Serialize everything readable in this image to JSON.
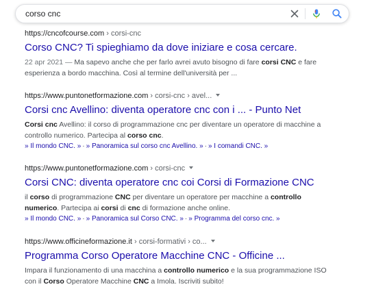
{
  "search": {
    "query": "corso cnc"
  },
  "results": [
    {
      "cite_domain": "https://cncofcourse.com",
      "cite_path": " › corsi-cnc",
      "title": "Corso CNC? Ti spieghiamo da dove iniziare e cosa cercare.",
      "snippet": [
        [
          {
            "t": "22 apr 2021 — ",
            "d": true
          },
          {
            "t": "Ma sapevo anche che per farlo avrei avuto bisogno di fare "
          },
          {
            "t": "corsi CNC",
            "b": true
          },
          {
            "t": " e fare"
          }
        ],
        [
          {
            "t": "esperienza a bordo macchina. Così al termine dell'università per ..."
          }
        ]
      ]
    },
    {
      "cite_domain": "https://www.puntonetformazione.com",
      "cite_path": " › corsi-cnc › avel...",
      "title": "Corsi cnc Avellino: diventa operatore cnc con i ... - Punto Net",
      "snippet": [
        [
          {
            "t": "Corsi cnc",
            "b": true
          },
          {
            "t": " Avellino: il corso di programmazione cnc per diventare un operatore di macchine a"
          }
        ],
        [
          {
            "t": "controllo numerico. Partecipa al "
          },
          {
            "t": "corso cnc",
            "b": true
          },
          {
            "t": "."
          }
        ]
      ],
      "sitelinks": [
        "» Il mondo CNC. »",
        "» Panoramica sul corso cnc Avellino. »",
        "» I comandi CNC. »"
      ]
    },
    {
      "cite_domain": "https://www.puntonetformazione.com",
      "cite_path": " › corsi-cnc",
      "title": "Corsi CNC: diventa operatore cnc coi Corsi di Formazione CNC",
      "snippet": [
        [
          {
            "t": "il "
          },
          {
            "t": "corso",
            "b": true
          },
          {
            "t": " di programmazione "
          },
          {
            "t": "CNC",
            "b": true
          },
          {
            "t": " per diventare un operatore per macchine a "
          },
          {
            "t": "controllo",
            "b": true
          }
        ],
        [
          {
            "t": "numerico",
            "b": true
          },
          {
            "t": ". Partecipa ai "
          },
          {
            "t": "corsi",
            "b": true
          },
          {
            "t": " di "
          },
          {
            "t": "cnc",
            "b": true
          },
          {
            "t": " di formazione anche online."
          }
        ]
      ],
      "sitelinks": [
        "» Il mondo CNC. »",
        "» Panoramica sul Corso CNC. »",
        "» Programma del corso cnc. »"
      ]
    },
    {
      "cite_domain": "https://www.officineformazione.it",
      "cite_path": " › corsi-formativi › co...",
      "title": "Programma Corso Operatore Macchine CNC - Officine ...",
      "snippet": [
        [
          {
            "t": "Impara il funzionamento di una macchina a "
          },
          {
            "t": "controllo numerico",
            "b": true
          },
          {
            "t": " e la sua programmazione ISO"
          }
        ],
        [
          {
            "t": "con il "
          },
          {
            "t": "Corso",
            "b": true
          },
          {
            "t": " Operatore Macchine "
          },
          {
            "t": "CNC",
            "b": true
          },
          {
            "t": " a Imola. Iscriviti subito!"
          }
        ]
      ]
    }
  ]
}
